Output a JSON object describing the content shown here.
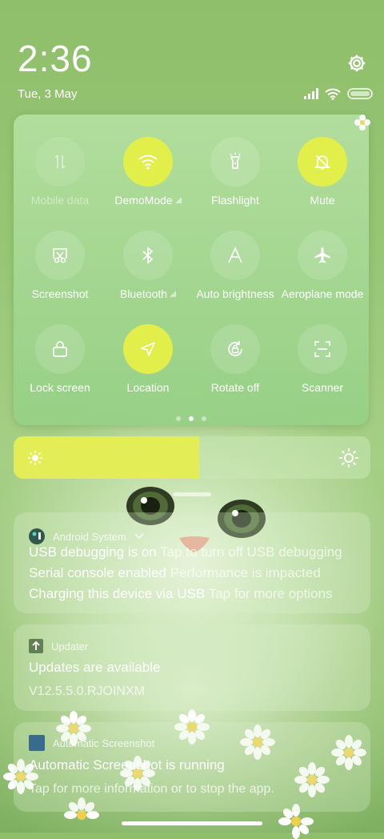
{
  "status": {
    "time": "2:36",
    "date": "Tue, 3 May"
  },
  "control_center": {
    "tiles": [
      {
        "label": "Mobile data",
        "icon": "mobile-data-icon",
        "state": "disabled"
      },
      {
        "label": "DemoMode",
        "icon": "wifi-icon",
        "state": "on"
      },
      {
        "label": "Flashlight",
        "icon": "flashlight-icon",
        "state": "off"
      },
      {
        "label": "Mute",
        "icon": "bell-off-icon",
        "state": "on"
      },
      {
        "label": "Screenshot",
        "icon": "scissors-icon",
        "state": "off"
      },
      {
        "label": "Bluetooth",
        "icon": "bluetooth-icon",
        "state": "off"
      },
      {
        "label": "Auto brightness",
        "icon": "brightness-a-icon",
        "state": "off"
      },
      {
        "label": "Aeroplane mode",
        "icon": "airplane-icon",
        "state": "off"
      },
      {
        "label": "Lock screen",
        "icon": "lock-icon",
        "state": "off"
      },
      {
        "label": "Location",
        "icon": "location-arrow-icon",
        "state": "on"
      },
      {
        "label": "Rotate off",
        "icon": "rotate-lock-icon",
        "state": "off"
      },
      {
        "label": "Scanner",
        "icon": "scanner-icon",
        "state": "off"
      }
    ],
    "page_count": 3,
    "active_page": 1
  },
  "brightness": {
    "level": 0.52
  },
  "notifications": {
    "android_system": {
      "app": "Android System",
      "lines": [
        {
          "title": "USB debugging is on",
          "text": "Tap to turn off USB debugging"
        },
        {
          "title": "Serial console enabled",
          "text": "Performance is impacted"
        },
        {
          "title": "Charging this device via USB",
          "text": "Tap for more options"
        }
      ]
    },
    "updater": {
      "app": "Updater",
      "title": "Updates are available",
      "text": "V12.5.5.0.RJOINXM"
    },
    "screenshot": {
      "app": "Automatic Screenshot",
      "title": "Automatic Screenshot is running",
      "text": "Tap for more information or to stop the app."
    }
  },
  "colors": {
    "accent_active": "#e2ee4a",
    "background": "#97c675"
  }
}
